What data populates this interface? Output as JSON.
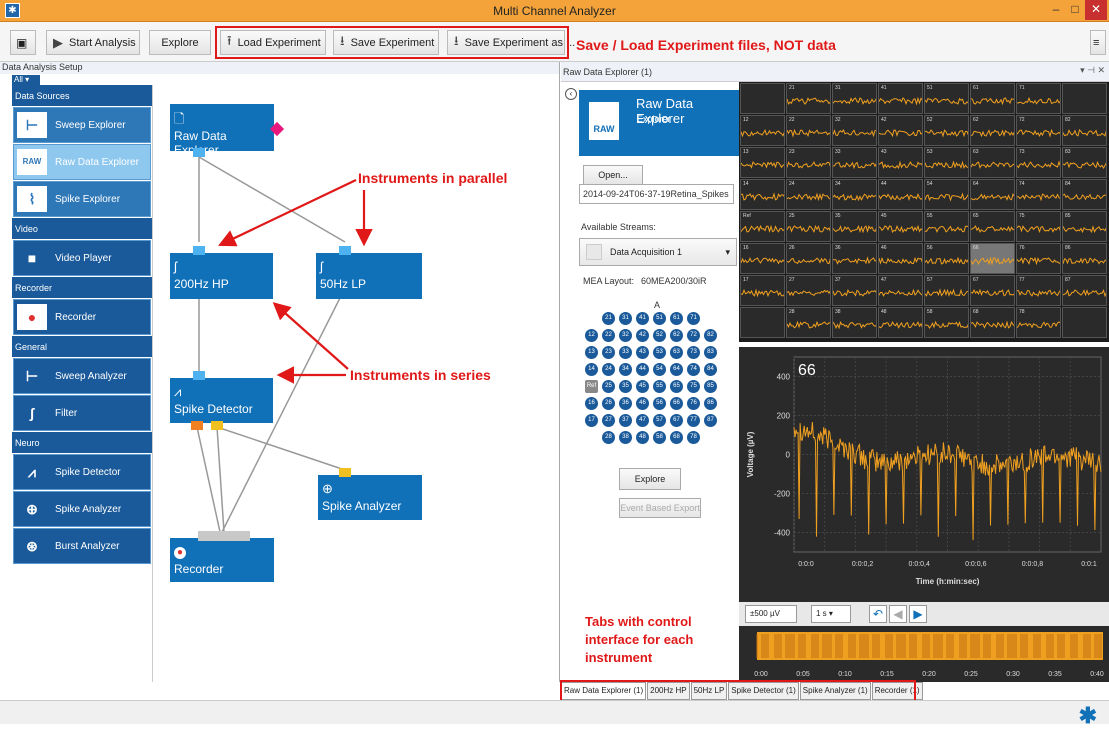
{
  "window": {
    "title": "Multi Channel Analyzer",
    "app_icon": "gear-icon"
  },
  "toolbar": {
    "start_analysis": "Start Analysis",
    "explore": "Explore",
    "load_experiment": "Load Experiment",
    "save_experiment": "Save Experiment",
    "save_experiment_as": "Save Experiment as ..."
  },
  "annotations": {
    "save_load": "Save / Load Experiment files, NOT data",
    "parallel": "Instruments in parallel",
    "series": "Instruments in series",
    "tabs_line1": "Tabs with control",
    "tabs_line2": "interface for each",
    "tabs_line3": "instrument",
    "color": "#e01818"
  },
  "left_panel": {
    "title": "Data Analysis Setup",
    "filter": "All",
    "categories": [
      {
        "name": "Data Sources",
        "items": [
          "Sweep Explorer",
          "Raw Data Explorer",
          "Spike Explorer"
        ]
      },
      {
        "name": "Video",
        "items": [
          "Video Player"
        ]
      },
      {
        "name": "Recorder",
        "items": [
          "Recorder"
        ]
      },
      {
        "name": "General",
        "items": [
          "Sweep Analyzer",
          "Filter"
        ]
      },
      {
        "name": "Neuro",
        "items": [
          "Spike Detector",
          "Spike Analyzer",
          "Burst Analyzer"
        ]
      }
    ]
  },
  "canvas_nodes": {
    "raw": "Raw Data Explorer",
    "hp": "200Hz HP",
    "lp": "50Hz LP",
    "spike_detector": "Spike Detector",
    "spike_analyzer": "Spike Analyzer",
    "recorder": "Recorder"
  },
  "right_panel": {
    "title": "Raw Data Explorer (1)",
    "tile_title": "Raw Data Explorer",
    "tile_sub": "Explorer",
    "raw_label": "RAW",
    "open_button": "Open...",
    "file_name": "2014-09-24T06-37-19Retina_Spikes",
    "available_streams_label": "Available Streams:",
    "stream_selected": "Data Acquisition 1",
    "mea_layout_label": "MEA Layout:",
    "mea_layout_value": "60MEA200/30iR",
    "grid_col_label": "A",
    "explore_button": "Explore",
    "event_export_button": "Event Based Export"
  },
  "electrodes": [
    [
      "",
      "21",
      "31",
      "41",
      "51",
      "61",
      "71",
      ""
    ],
    [
      "12",
      "22",
      "32",
      "42",
      "52",
      "62",
      "72",
      "82"
    ],
    [
      "13",
      "23",
      "33",
      "43",
      "53",
      "63",
      "73",
      "83"
    ],
    [
      "14",
      "24",
      "34",
      "44",
      "54",
      "64",
      "74",
      "84"
    ],
    [
      "Ref",
      "25",
      "35",
      "45",
      "55",
      "65",
      "75",
      "85"
    ],
    [
      "16",
      "26",
      "36",
      "46",
      "56",
      "66",
      "76",
      "86"
    ],
    [
      "17",
      "27",
      "37",
      "47",
      "57",
      "67",
      "77",
      "87"
    ],
    [
      "",
      "28",
      "38",
      "48",
      "58",
      "68",
      "78",
      ""
    ]
  ],
  "channel_grid": [
    [
      "",
      "21",
      "31",
      "41",
      "51",
      "61",
      "71",
      ""
    ],
    [
      "12",
      "22",
      "32",
      "42",
      "52",
      "62",
      "72",
      "82"
    ],
    [
      "13",
      "23",
      "33",
      "43",
      "53",
      "63",
      "73",
      "83"
    ],
    [
      "14",
      "24",
      "34",
      "44",
      "54",
      "64",
      "74",
      "84"
    ],
    [
      "Ref",
      "25",
      "35",
      "45",
      "55",
      "65",
      "75",
      "85"
    ],
    [
      "16",
      "26",
      "36",
      "46",
      "56",
      "66",
      "76",
      "86"
    ],
    [
      "17",
      "27",
      "37",
      "47",
      "57",
      "67",
      "77",
      "87"
    ],
    [
      "",
      "28",
      "38",
      "48",
      "58",
      "68",
      "78",
      ""
    ]
  ],
  "selected_channel": "66",
  "detail_plot": {
    "channel_label": "66",
    "ylabel": "Voltage (µV)",
    "xlabel": "Time (h:min:sec)",
    "yticks": [
      "400",
      "200",
      "0",
      "-200",
      "-400"
    ],
    "xticks": [
      "0:0:0",
      "0:0:0,2",
      "0:0:0,4",
      "0:0:0,6",
      "0:0:0,8",
      "0:0:1"
    ],
    "trace_color": "#f0a020"
  },
  "display_controls": {
    "range": "±500 µV",
    "time": "1 s ▾"
  },
  "overview_ticks": [
    "0:00",
    "0:05",
    "0:10",
    "0:15",
    "0:20",
    "0:25",
    "0:30",
    "0:35",
    "0:40"
  ],
  "tabs": [
    "Raw Data Explorer (1)",
    "200Hz HP",
    "50Hz LP",
    "Spike Detector (1)",
    "Spike Analyzer (1)",
    "Recorder (1)"
  ]
}
